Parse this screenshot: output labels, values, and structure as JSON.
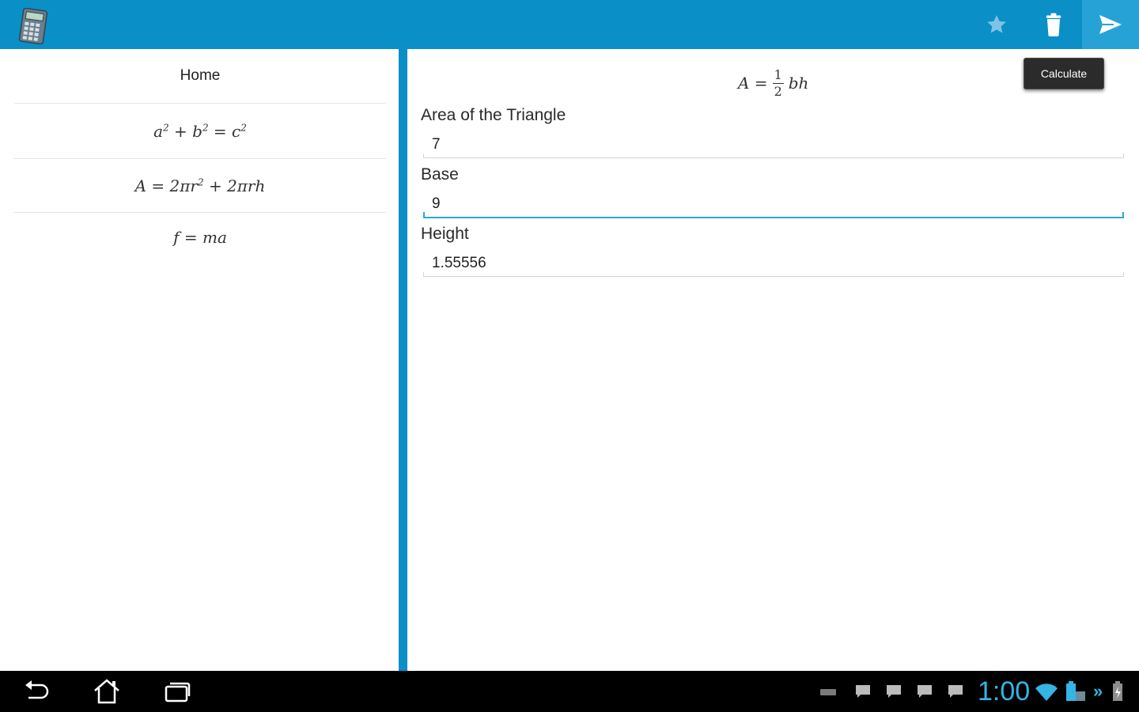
{
  "toolbar": {
    "app_icon": "calculator-icon",
    "favorite_icon": "star-icon",
    "delete_icon": "trash-icon",
    "calculate_icon": "send-icon",
    "tooltip": "Calculate"
  },
  "sidebar": {
    "items": [
      {
        "label": "Home"
      },
      {
        "formula": "pythagorean-formula"
      },
      {
        "formula": "cylinder-area-formula"
      },
      {
        "formula": "force-formula"
      }
    ]
  },
  "main": {
    "formula": "triangle-area-formula",
    "fields": [
      {
        "label": "Area of the Triangle",
        "value": "7"
      },
      {
        "label": "Base",
        "value": "9"
      },
      {
        "label": "Height",
        "value": "1.55556"
      }
    ]
  },
  "status_bar": {
    "time": "1:00"
  },
  "colors": {
    "accent": "#0a8fc7",
    "clock": "#33b5e5",
    "focus_line": "#2aa6d8"
  }
}
